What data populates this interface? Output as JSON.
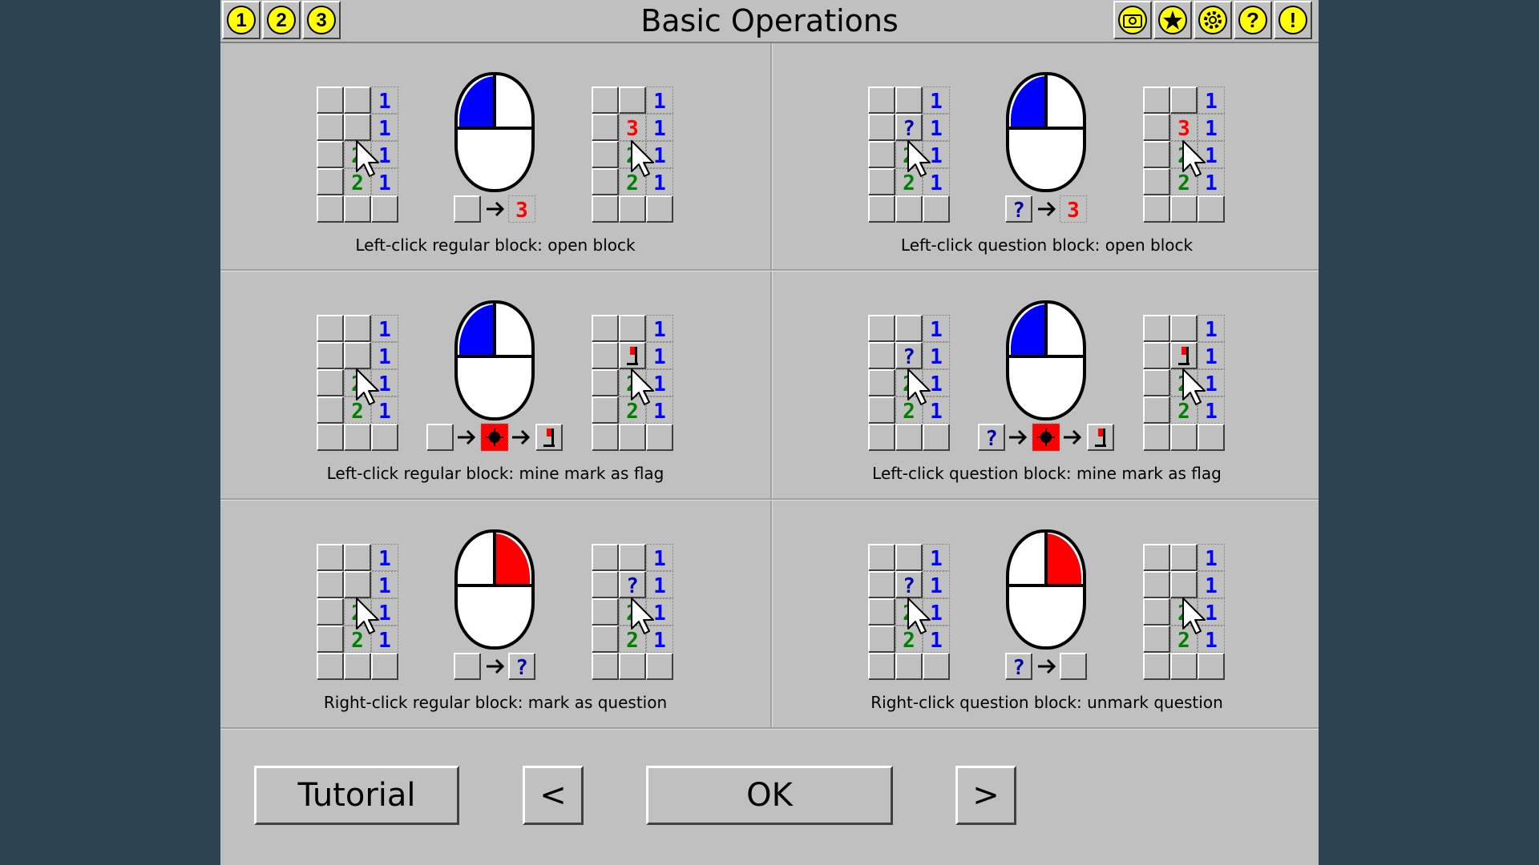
{
  "header": {
    "title": "Basic Operations",
    "level_buttons": [
      "1",
      "2",
      "3"
    ],
    "tool_icons": [
      "camera-icon",
      "star-icon",
      "gear-icon",
      "help-icon",
      "alert-icon"
    ]
  },
  "sections": [
    {
      "caption": "Left-click regular block: open block"
    },
    {
      "caption": "Left-click question block: open block"
    },
    {
      "caption": "Left-click regular block: mine mark as flag"
    },
    {
      "caption": "Left-click question block: mine mark as flag"
    },
    {
      "caption": "Right-click regular block: mark as question"
    },
    {
      "caption": "Right-click question block: unmark question"
    }
  ],
  "footer": {
    "tutorial_label": "Tutorial",
    "prev_label": "<",
    "ok_label": "OK",
    "next_label": ">"
  },
  "colors": {
    "panel": "#c0c0c0",
    "background": "#2b4550",
    "left_click": "#0000ff",
    "right_click": "#ff0000",
    "icon_yellow": "#ffff00"
  }
}
